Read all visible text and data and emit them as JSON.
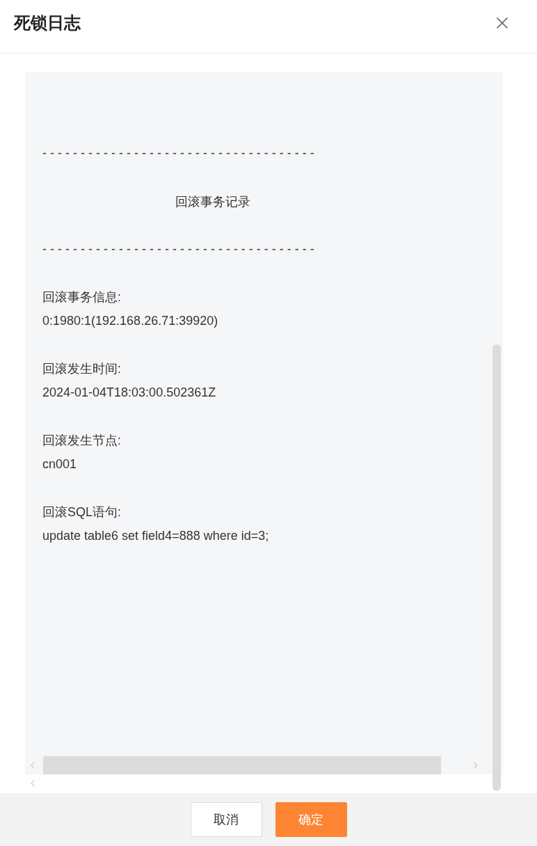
{
  "dialog": {
    "title": "死锁日志"
  },
  "log": {
    "separator_top": "- - - - - - - - - - - - - - - - - - - - - - - - - - - - - - - - - - - -",
    "heading": "回滚事务记录",
    "separator_bottom": "- - - - - - - - - - - - - - - - - - - - - - - - - - - - - - - - - - - -",
    "fields": [
      {
        "label": "回滚事务信息:",
        "value": "0:1980:1(192.168.26.71:39920)"
      },
      {
        "label": "回滚发生时间:",
        "value": "2024-01-04T18:03:00.502361Z"
      },
      {
        "label": "回滚发生节点:",
        "value": "cn001"
      },
      {
        "label": "回滚SQL语句:",
        "value": "update table6 set field4=888 where id=3;"
      }
    ]
  },
  "footer": {
    "buttons": [
      {
        "label": "取消",
        "kind": "secondary"
      },
      {
        "label": "确定",
        "kind": "primary"
      }
    ]
  }
}
